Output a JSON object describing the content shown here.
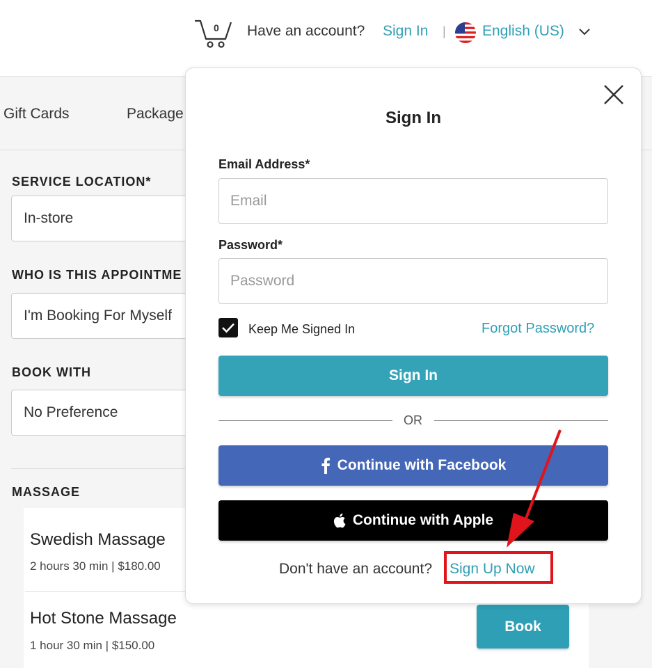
{
  "header": {
    "cart_count": "0",
    "have_account": "Have an account?",
    "sign_in": "Sign In",
    "separator": "|",
    "language": "English (US)"
  },
  "nav": {
    "gift_cards": "Gift Cards",
    "packages": "Package"
  },
  "form": {
    "service_location_label": "SERVICE LOCATION*",
    "service_location_value": "In-store",
    "who_label": "WHO IS THIS APPOINTME",
    "who_value": "I'm Booking For Myself",
    "book_with_label": "BOOK WITH",
    "book_with_value": "No Preference",
    "massage_label": "MASSAGE"
  },
  "services": [
    {
      "name": "Swedish Massage",
      "meta": "2 hours 30 min | $180.00"
    },
    {
      "name": "Hot Stone Massage",
      "meta": "1 hour 30 min | $150.00",
      "action": "Book"
    }
  ],
  "modal": {
    "title": "Sign In",
    "email_label": "Email Address*",
    "email_placeholder": "Email",
    "password_label": "Password*",
    "password_placeholder": "Password",
    "keep_signed_in": "Keep Me Signed In",
    "keep_signed_in_checked": true,
    "forgot_password": "Forgot Password?",
    "sign_in_button": "Sign In",
    "or": "OR",
    "facebook_button": "Continue with Facebook",
    "apple_button": "Continue with Apple",
    "no_account": "Don't have an account?",
    "sign_up": "Sign Up Now"
  },
  "colors": {
    "accent": "#2e9fb5",
    "facebook": "#4567b7",
    "apple": "#000000",
    "highlight": "#e0141a"
  }
}
